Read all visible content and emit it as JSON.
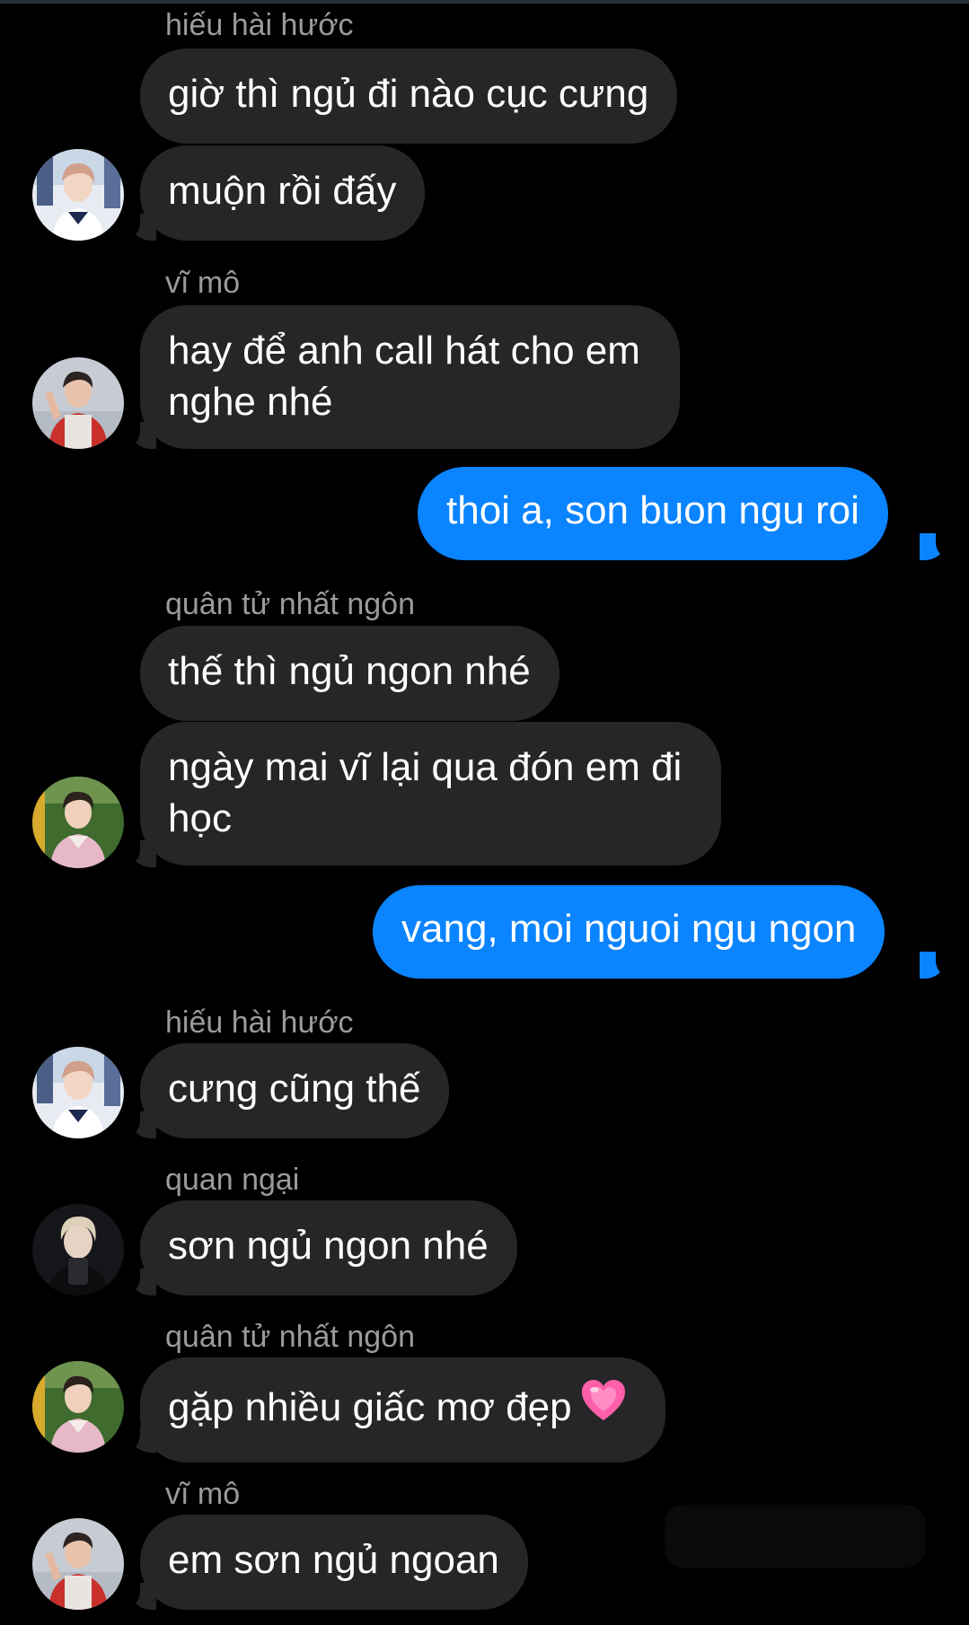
{
  "conversation": [
    {
      "kind": "sender",
      "text": "hiếu hài hước"
    },
    {
      "kind": "incoming",
      "text": "giờ thì ngủ đi nào cục cưng"
    },
    {
      "kind": "incoming",
      "text": "muộn rồi đấy",
      "avatar": "avatar-hieu-hai-huoc"
    },
    {
      "kind": "sender",
      "text": "vĩ mô"
    },
    {
      "kind": "incoming",
      "lines": [
        "hay để anh call hát cho em",
        "nghe nhé"
      ],
      "avatar": "avatar-vi-mo"
    },
    {
      "kind": "outgoing",
      "text": "thoi a, son buon ngu roi"
    },
    {
      "kind": "sender",
      "text": "quân tử nhất ngôn"
    },
    {
      "kind": "incoming",
      "text": "thế thì ngủ ngon nhé"
    },
    {
      "kind": "incoming",
      "lines": [
        "ngày mai vĩ lại qua đón em đi",
        "học"
      ],
      "avatar": "avatar-quan-tu-nhat-ngon"
    },
    {
      "kind": "outgoing",
      "text": "vang, moi nguoi ngu ngon"
    },
    {
      "kind": "sender",
      "text": "hiếu hài hước"
    },
    {
      "kind": "incoming",
      "text": "cưng cũng thế",
      "avatar": "avatar-hieu-hai-huoc"
    },
    {
      "kind": "sender",
      "text": "quan ngại"
    },
    {
      "kind": "incoming",
      "text": "sơn ngủ ngon nhé",
      "avatar": "avatar-quan-ngai"
    },
    {
      "kind": "sender",
      "text": "quân tử nhất ngôn"
    },
    {
      "kind": "incoming",
      "text": "gặp nhiều giấc mơ đẹp",
      "emoji": "growing-heart-icon",
      "avatar": "avatar-quan-tu-nhat-ngon"
    },
    {
      "kind": "sender",
      "text": "vĩ mô"
    },
    {
      "kind": "incoming",
      "text": "em sơn ngủ ngoan",
      "avatar": "avatar-vi-mo"
    }
  ],
  "colors": {
    "background": "#000000",
    "incoming_bubble": "#262628",
    "outgoing_bubble": "#0a84ff",
    "sender_name": "#9a9a9f",
    "text": "#ffffff",
    "heart": "#ff5fa8"
  }
}
